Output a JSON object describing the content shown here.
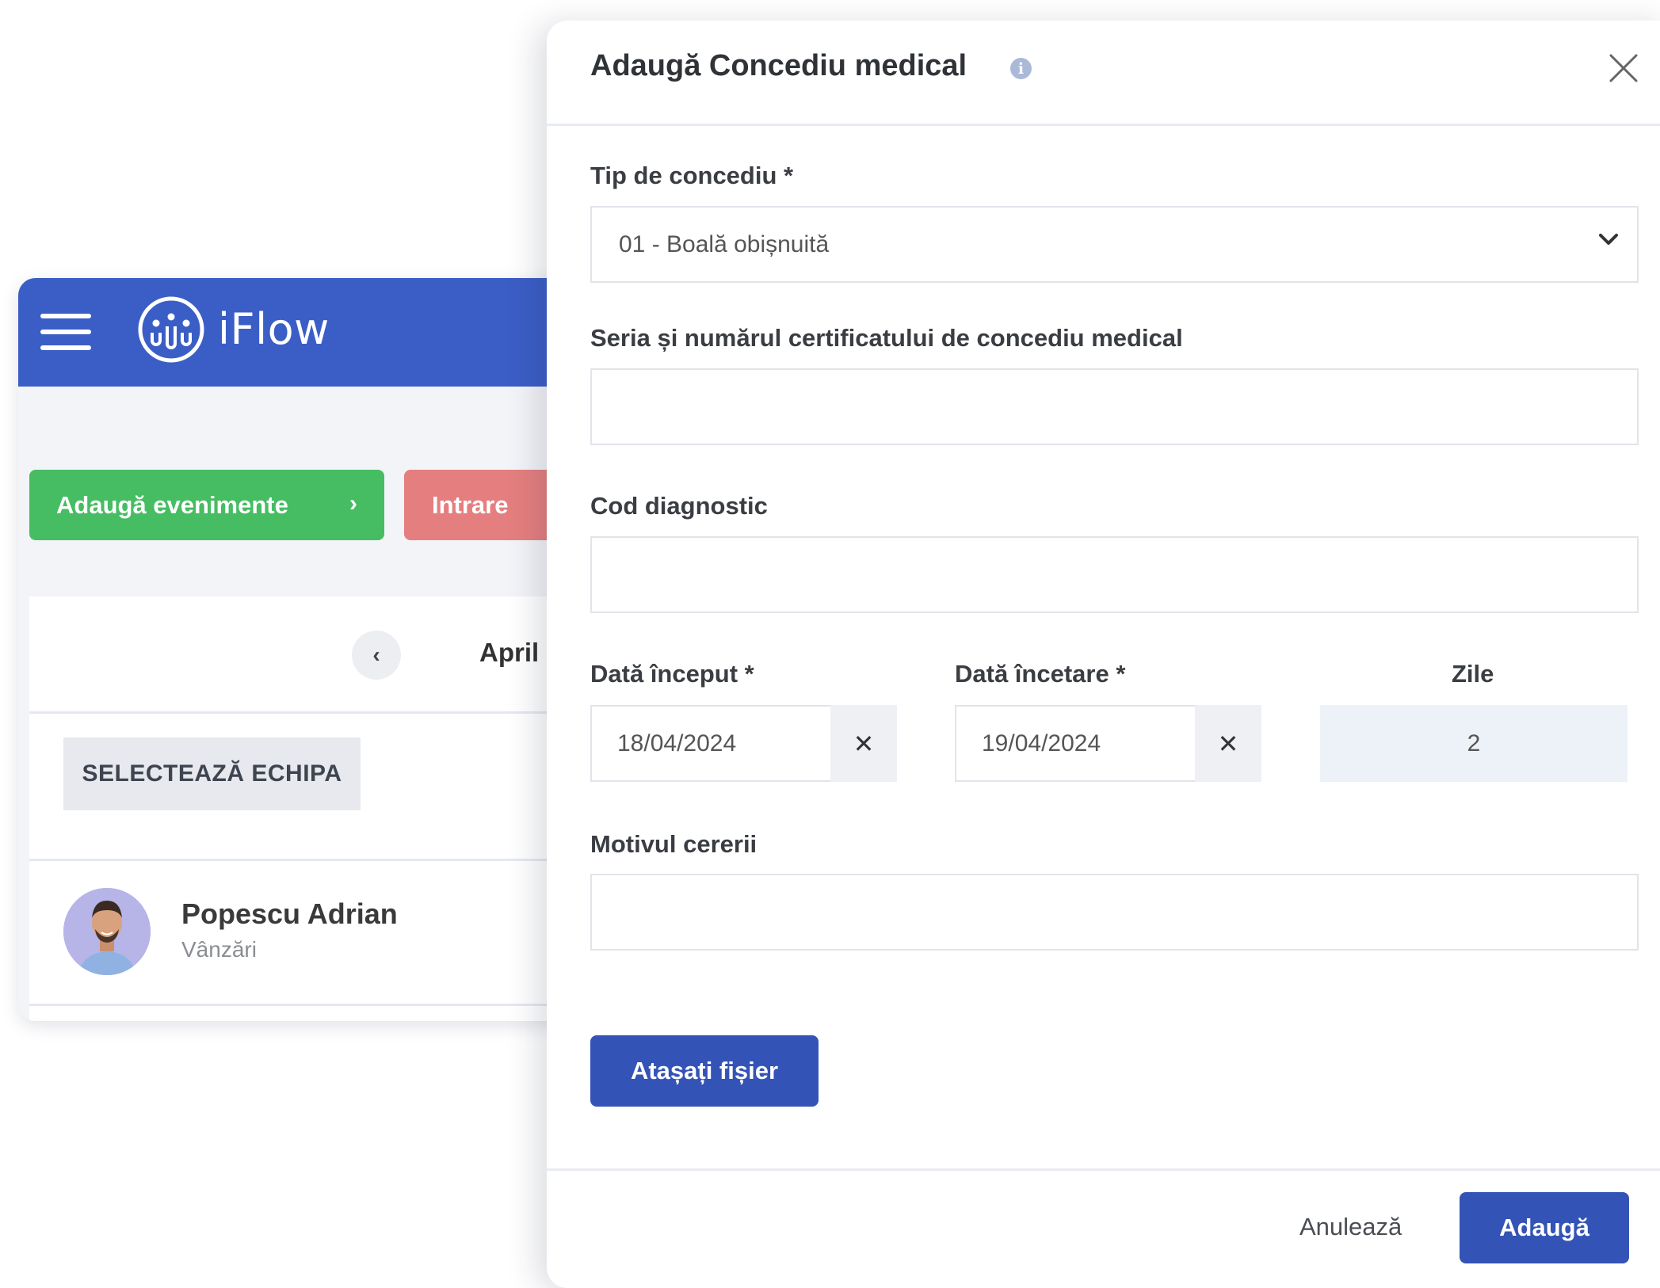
{
  "app": {
    "name": "iFlow",
    "add_events_label": "Adaugă evenimente",
    "entry_label": "Intrare",
    "month_label": "April",
    "select_team_label": "SELECTEAZĂ ECHIPA",
    "employee": {
      "name": "Popescu Adrian",
      "department": "Vânzări"
    },
    "colors": {
      "header": "#3b5ec6",
      "add_button": "#46bd62",
      "entry_button": "#e57f7f"
    }
  },
  "modal": {
    "title": "Adaugă Concediu medical",
    "leave_type": {
      "label": "Tip de concediu *",
      "value": "01 - Boală obișnuită"
    },
    "certificate": {
      "label": "Seria și numărul certificatului de concediu medical",
      "value": ""
    },
    "diagnostic": {
      "label": "Cod diagnostic",
      "value": ""
    },
    "start_date": {
      "label": "Dată început *",
      "value": "18/04/2024"
    },
    "end_date": {
      "label": "Dată încetare *",
      "value": "19/04/2024"
    },
    "days": {
      "label": "Zile",
      "value": "2"
    },
    "reason": {
      "label": "Motivul cererii",
      "value": ""
    },
    "attach_label": "Atașați fișier",
    "cancel_label": "Anulează",
    "submit_label": "Adaugă",
    "colors": {
      "primary": "#3453b6"
    },
    "icons": {
      "info": "info-icon",
      "close": "close-icon",
      "clear": "clear-x-icon",
      "dropdown": "chevron-down-icon"
    }
  }
}
